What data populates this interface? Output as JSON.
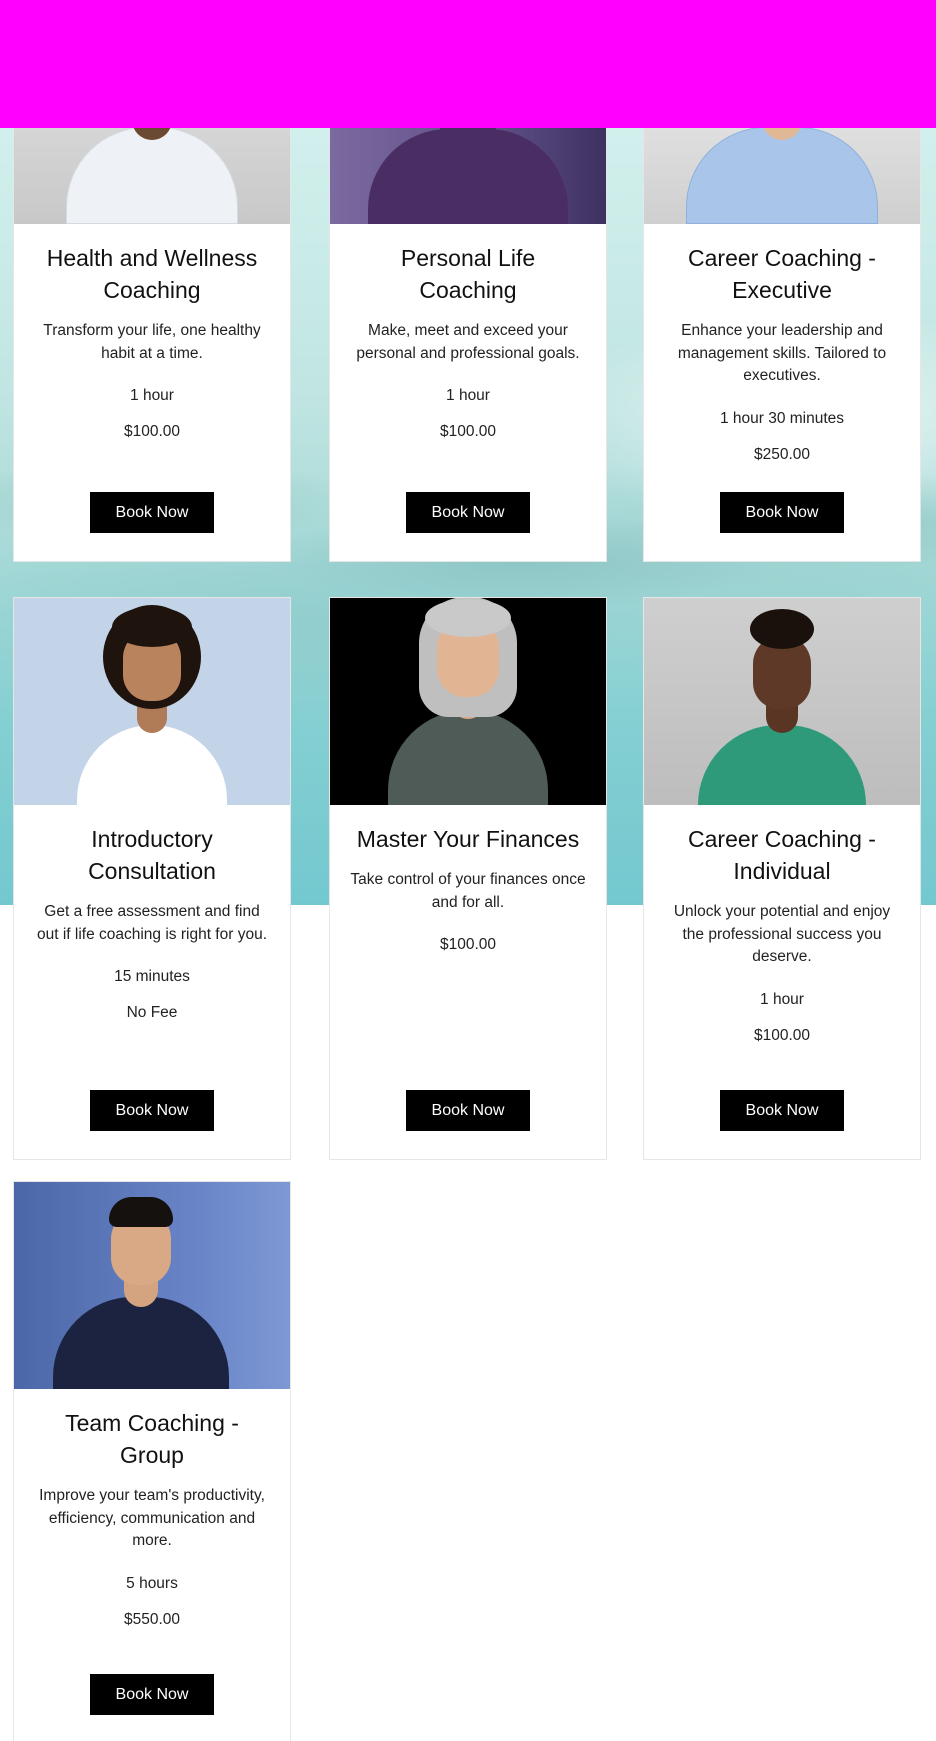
{
  "banner": {
    "color": "#ff00ff"
  },
  "colors": {
    "button_bg": "#000000",
    "button_text": "#ffffff"
  },
  "services": [
    {
      "title": "Health and Wellness Coaching",
      "description": "Transform your life, one healthy habit at a time.",
      "duration": "1 hour",
      "price": "$100.00",
      "button_label": "Book Now",
      "image_icon": "man-portrait-icon"
    },
    {
      "title": "Personal Life Coaching",
      "description": "Make, meet and exceed your personal and professional goals.",
      "duration": "1 hour",
      "price": "$100.00",
      "button_label": "Book Now",
      "image_icon": "man-portrait-icon"
    },
    {
      "title": "Career Coaching - Executive",
      "description": "Enhance your leadership and management skills. Tailored to executives.",
      "duration": "1 hour 30 minutes",
      "price": "$250.00",
      "button_label": "Book Now",
      "image_icon": "man-portrait-icon"
    },
    {
      "title": "Introductory Consultation",
      "description": "Get a free assessment and find out if life coaching is right for you.",
      "duration": "15 minutes",
      "price": "No Fee",
      "button_label": "Book Now",
      "image_icon": "woman-portrait-icon"
    },
    {
      "title": "Master Your Finances",
      "description": "Take control of your finances once and for all.",
      "duration": "",
      "price": "$100.00",
      "button_label": "Book Now",
      "image_icon": "woman-portrait-icon"
    },
    {
      "title": "Career Coaching - Individual",
      "description": "Unlock your potential and enjoy the professional success you deserve.",
      "duration": "1 hour",
      "price": "$100.00",
      "button_label": "Book Now",
      "image_icon": "woman-portrait-icon"
    },
    {
      "title": "Team Coaching - Group",
      "description": "Improve your team's productivity, efficiency, communication and more.",
      "duration": "5 hours",
      "price": "$550.00",
      "button_label": "Book Now",
      "image_icon": "man-portrait-icon"
    }
  ]
}
